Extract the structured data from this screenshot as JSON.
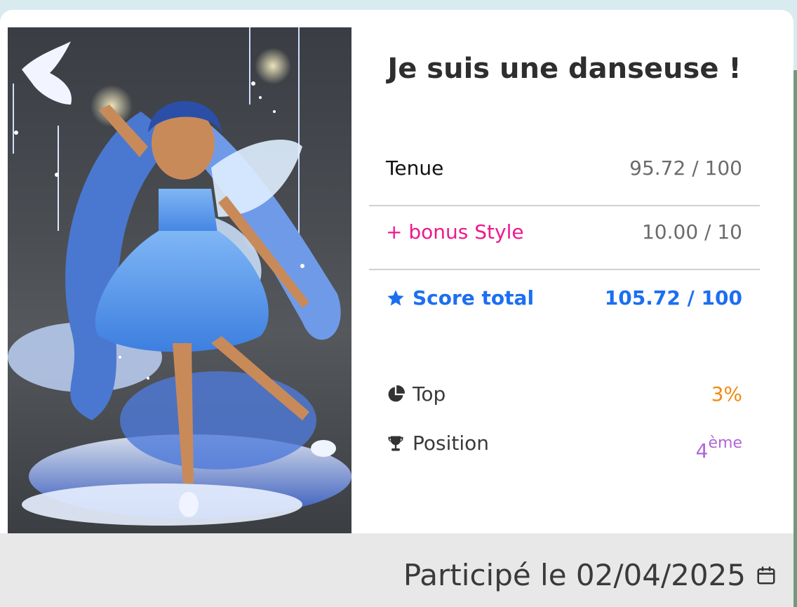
{
  "card": {
    "title": "Je suis une danseuse !",
    "scores": {
      "tenue_label": "Tenue",
      "tenue_value": "95.72 / 100",
      "bonus_label": "+ bonus Style",
      "bonus_value": "10.00 / 10",
      "total_label": "Score total",
      "total_value": "105.72 / 100"
    },
    "stats": {
      "top_label": "Top",
      "top_value": "3%",
      "position_label": "Position",
      "position_number": "4",
      "position_suffix": "ème"
    },
    "footer": {
      "participated": "Participé le 02/04/2025"
    },
    "icons": {
      "total": "star-icon",
      "top": "pie-chart-icon",
      "position": "trophy-icon",
      "date": "calendar-icon"
    },
    "colors": {
      "bonus": "#ec1a8e",
      "total": "#1c6ff0",
      "top": "#f28a0f",
      "position": "#b066d8"
    }
  }
}
